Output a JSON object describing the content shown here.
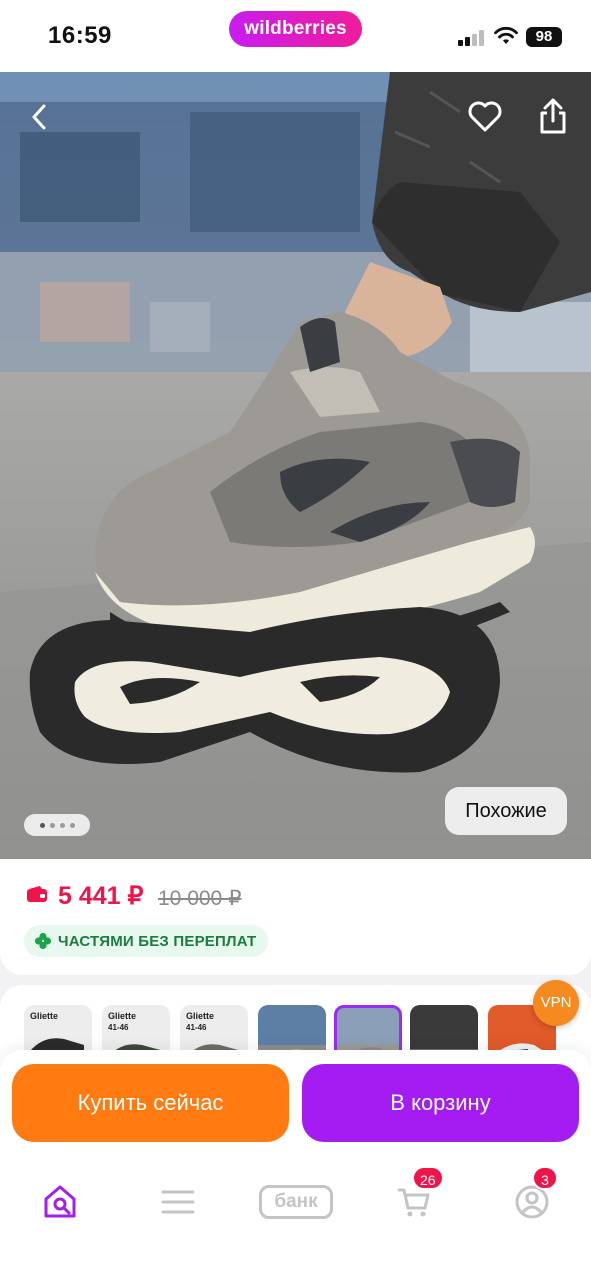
{
  "status_bar": {
    "time": "16:59",
    "brand": "wildberries",
    "battery": "98"
  },
  "hero": {
    "similar_label": "Похожие",
    "photo_count": 4,
    "active_photo_index": 0,
    "product_description": "grey and cream mesh running sneaker with black sole"
  },
  "price": {
    "current": "5 441 ₽",
    "old": "10 000 ₽",
    "current_color": "#f0144b",
    "installment_label": "ЧАСТЯМИ БЕЗ ПЕРЕПЛАТ"
  },
  "thumbnails": [
    {
      "label": "Gliette",
      "label2": ""
    },
    {
      "label": "Gliette",
      "label2": "41-46"
    },
    {
      "label": "Gliette",
      "label2": "41-46"
    },
    {
      "label": "",
      "label2": ""
    },
    {
      "label": "",
      "label2": ""
    },
    {
      "label": "",
      "label2": ""
    },
    {
      "label": "",
      "label2": ""
    }
  ],
  "vpn_badge": "VPN",
  "actions": {
    "buy_now": "Купить сейчас",
    "add_to_cart": "В корзину",
    "buy_now_color": "#ff7a11",
    "add_to_cart_color": "#a51cf2"
  },
  "bottom_nav": {
    "items": [
      {
        "icon": "home-search-icon"
      },
      {
        "icon": "menu-icon"
      },
      {
        "icon": "bank-icon",
        "label": "банк"
      },
      {
        "icon": "cart-icon",
        "badge": "26"
      },
      {
        "icon": "profile-icon",
        "badge": "3"
      }
    ],
    "accent": "#a51cf2"
  }
}
